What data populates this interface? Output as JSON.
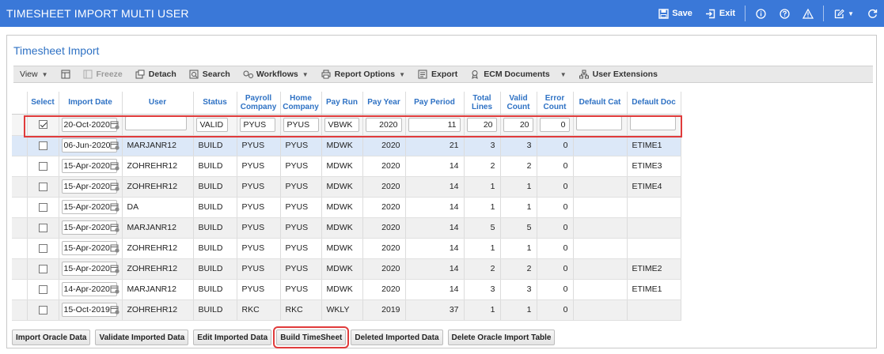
{
  "app": {
    "title": "TIMESHEET IMPORT MULTI USER",
    "save_label": "Save",
    "exit_label": "Exit"
  },
  "section_title": "Timesheet Import",
  "toolbar": {
    "view": "View",
    "freeze": "Freeze",
    "detach": "Detach",
    "search": "Search",
    "workflows": "Workflows",
    "report_options": "Report Options",
    "export": "Export",
    "ecm_documents": "ECM Documents",
    "user_extensions": "User Extensions"
  },
  "columns": {
    "select": "Select",
    "import_date": "Import Date",
    "user": "User",
    "status": "Status",
    "payroll_company": "Payroll Company",
    "home_company": "Home Company",
    "pay_run": "Pay Run",
    "pay_year": "Pay Year",
    "pay_period": "Pay Period",
    "total_lines": "Total Lines",
    "valid_count": "Valid Count",
    "error_count": "Error Count",
    "default_cat": "Default Cat",
    "default_doc": "Default Doc"
  },
  "edit_row": {
    "checked": true,
    "import_date": "20-Oct-2020",
    "user": "",
    "status": "VALID",
    "payroll_company": "PYUS",
    "home_company": "PYUS",
    "pay_run": "VBWK",
    "pay_year": "2020",
    "pay_period": "11",
    "total_lines": "20",
    "valid_count": "20",
    "error_count": "0",
    "default_cat": "",
    "default_doc": ""
  },
  "rows": [
    {
      "import_date": "06-Jun-2020",
      "user": "MARJANR12",
      "status": "BUILD",
      "payroll_company": "PYUS",
      "home_company": "PYUS",
      "pay_run": "MDWK",
      "pay_year": "2020",
      "pay_period": "21",
      "total_lines": "3",
      "valid_count": "3",
      "error_count": "0",
      "default_cat": "",
      "default_doc": "ETIME1"
    },
    {
      "import_date": "15-Apr-2020",
      "user": "ZOHREHR12",
      "status": "BUILD",
      "payroll_company": "PYUS",
      "home_company": "PYUS",
      "pay_run": "MDWK",
      "pay_year": "2020",
      "pay_period": "14",
      "total_lines": "2",
      "valid_count": "2",
      "error_count": "0",
      "default_cat": "",
      "default_doc": "ETIME3"
    },
    {
      "import_date": "15-Apr-2020",
      "user": "ZOHREHR12",
      "status": "BUILD",
      "payroll_company": "PYUS",
      "home_company": "PYUS",
      "pay_run": "MDWK",
      "pay_year": "2020",
      "pay_period": "14",
      "total_lines": "1",
      "valid_count": "1",
      "error_count": "0",
      "default_cat": "",
      "default_doc": "ETIME4"
    },
    {
      "import_date": "15-Apr-2020",
      "user": "DA",
      "status": "BUILD",
      "payroll_company": "PYUS",
      "home_company": "PYUS",
      "pay_run": "MDWK",
      "pay_year": "2020",
      "pay_period": "14",
      "total_lines": "1",
      "valid_count": "1",
      "error_count": "0",
      "default_cat": "",
      "default_doc": ""
    },
    {
      "import_date": "15-Apr-2020",
      "user": "MARJANR12",
      "status": "BUILD",
      "payroll_company": "PYUS",
      "home_company": "PYUS",
      "pay_run": "MDWK",
      "pay_year": "2020",
      "pay_period": "14",
      "total_lines": "5",
      "valid_count": "5",
      "error_count": "0",
      "default_cat": "",
      "default_doc": ""
    },
    {
      "import_date": "15-Apr-2020",
      "user": "ZOHREHR12",
      "status": "BUILD",
      "payroll_company": "PYUS",
      "home_company": "PYUS",
      "pay_run": "MDWK",
      "pay_year": "2020",
      "pay_period": "14",
      "total_lines": "1",
      "valid_count": "1",
      "error_count": "0",
      "default_cat": "",
      "default_doc": ""
    },
    {
      "import_date": "15-Apr-2020",
      "user": "ZOHREHR12",
      "status": "BUILD",
      "payroll_company": "PYUS",
      "home_company": "PYUS",
      "pay_run": "MDWK",
      "pay_year": "2020",
      "pay_period": "14",
      "total_lines": "2",
      "valid_count": "2",
      "error_count": "0",
      "default_cat": "",
      "default_doc": "ETIME2"
    },
    {
      "import_date": "14-Apr-2020",
      "user": "MARJANR12",
      "status": "BUILD",
      "payroll_company": "PYUS",
      "home_company": "PYUS",
      "pay_run": "MDWK",
      "pay_year": "2020",
      "pay_period": "14",
      "total_lines": "3",
      "valid_count": "3",
      "error_count": "0",
      "default_cat": "",
      "default_doc": "ETIME1"
    },
    {
      "import_date": "15-Oct-2019",
      "user": "ZOHREHR12",
      "status": "BUILD",
      "payroll_company": "RKC",
      "home_company": "RKC",
      "pay_run": "WKLY",
      "pay_year": "2019",
      "pay_period": "37",
      "total_lines": "1",
      "valid_count": "1",
      "error_count": "0",
      "default_cat": "",
      "default_doc": ""
    }
  ],
  "buttons": {
    "import_oracle": "Import Oracle Data",
    "validate": "Validate Imported Data",
    "edit": "Edit Imported Data",
    "build": "Build TimeSheet",
    "deleted": "Deleted Imported Data",
    "delete_oracle": "Delete Oracle Import Table"
  },
  "colors": {
    "titlebar": "#3a78d8",
    "header_text": "#2f72c4",
    "highlight": "#e03b3b",
    "selected_row": "#dce8f8"
  }
}
